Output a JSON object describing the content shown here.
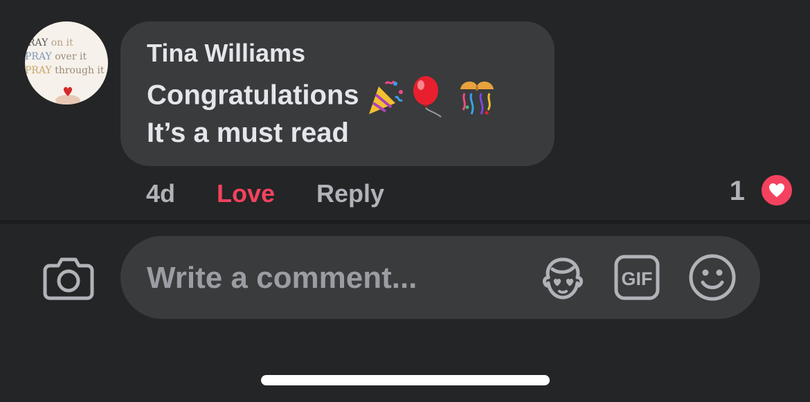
{
  "comment": {
    "author": "Tina Williams",
    "lines": [
      "Congratulations",
      "It’s a must read"
    ],
    "emojis": [
      "party-popper",
      "balloon",
      "confetti-ball"
    ],
    "avatar": {
      "line1_strong": "RAY",
      "line1_rest": " on it",
      "line2_strong": "PRAY",
      "line2_rest": " over it",
      "line3_strong": "PRAY",
      "line3_rest": " through it"
    },
    "time": "4d",
    "love_label": "Love",
    "reply_label": "Reply",
    "reaction_count": "1",
    "reaction_icon": "heart-reaction-icon"
  },
  "composer": {
    "placeholder": "Write a comment...",
    "gif_label": "GIF",
    "icons": [
      "camera-icon",
      "avatar-sticker-icon",
      "gif-icon",
      "emoji-icon"
    ]
  },
  "colors": {
    "background": "#242526",
    "bubble": "#3a3b3c",
    "text": "#e4e6eb",
    "muted": "#b0b3b8",
    "love": "#f3425f"
  }
}
